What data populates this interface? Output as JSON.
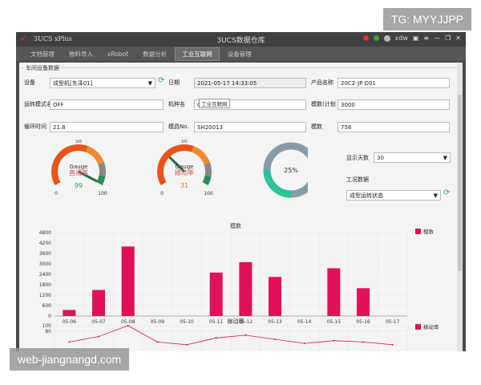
{
  "watermarks": {
    "top": "TG: MYYJJPP",
    "bottom": "web-jiangnangd.com"
  },
  "window": {
    "app_name": "3UCS xPlus",
    "title": "3UCS数据仓库",
    "user": "xdw",
    "status_color": "#d33333"
  },
  "menu": [
    "文档管理",
    "物料导入",
    "xRobot",
    "数据分析",
    "工业互联网",
    "设备管理"
  ],
  "active_tab": "工业互联网",
  "tooltip": "工业互联网",
  "group_title": "车间设备数据",
  "form": {
    "device": {
      "label": "设备",
      "value": "成型机[东泽01]"
    },
    "date": {
      "label": "日期",
      "value": "2021-05-17 14:33:05"
    },
    "product": {
      "label": "产品名称",
      "value": "20C2-JP D01"
    },
    "run_mode": {
      "label": "运转模式名",
      "value": "OFF"
    },
    "machine": {
      "label": "机种名",
      "value": "CS-130"
    },
    "plan_count": {
      "label": "模数(计划",
      "value": "3000"
    },
    "cycle_time": {
      "label": "循环时间",
      "value": "21.8"
    },
    "mold_no": {
      "label": "模具No.",
      "value": "SH20013"
    },
    "mold_count": {
      "label": "模数",
      "value": "758"
    },
    "display_days": {
      "label": "显示天数",
      "value": "30"
    },
    "work_data": {
      "label": "工况数据",
      "value": "成型运转状态"
    }
  },
  "gauges": [
    {
      "name": "直通率",
      "label": "Gauge",
      "value": 99,
      "min": 0,
      "max": 100,
      "top": 50,
      "value_color": "#3a9a3a",
      "name_color": "#e05050"
    },
    {
      "name": "稼动率",
      "label": "Gauge",
      "value": 31,
      "min": 0,
      "max": 100,
      "top": 50,
      "value_color": "#e07a10",
      "name_color": "#e05050"
    }
  ],
  "donut": {
    "percent": 25,
    "label": "25%",
    "fill_color": "#2cc49a",
    "track_color": "#8a9aa6"
  },
  "chart_data": [
    {
      "type": "bar",
      "title": "模数",
      "categories": [
        "05-06",
        "05-07",
        "05-08",
        "05-09",
        "05-10",
        "05-11",
        "05-12",
        "05-13",
        "05-14",
        "05-15",
        "05-16",
        "05-17"
      ],
      "series": [
        {
          "name": "模数",
          "values": [
            350,
            1500,
            4000,
            0,
            0,
            2500,
            3100,
            2250,
            0,
            2750,
            1600,
            0
          ]
        }
      ],
      "y_ticks": [
        "0",
        "600",
        "1200",
        "1800",
        "2400",
        "3000",
        "3600",
        "4200",
        "4800"
      ],
      "ylim": [
        0,
        4800
      ],
      "grid": true,
      "legend": "top-right",
      "color": "#e0105a"
    },
    {
      "type": "line",
      "title": "稼动率",
      "categories": [
        "05-06",
        "05-07",
        "05-08",
        "05-09",
        "05-10",
        "05-11",
        "05-12",
        "05-13",
        "05-14",
        "05-15",
        "05-16",
        "05-17"
      ],
      "series": [
        {
          "name": "稼动率",
          "values": [
            40,
            60,
            100,
            40,
            30,
            55,
            65,
            50,
            35,
            45,
            40,
            30
          ]
        }
      ],
      "y_ticks": [
        "100",
        "80"
      ],
      "ylim": [
        0,
        100
      ],
      "grid": true,
      "legend": "top-right",
      "color": "#e0105a"
    }
  ]
}
